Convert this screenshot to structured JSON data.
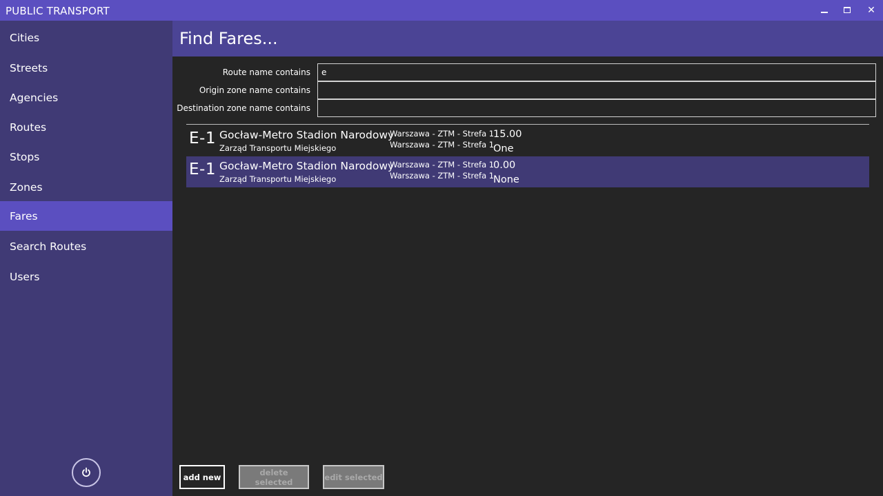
{
  "window": {
    "title": "PUBLIC TRANSPORT",
    "controls": {
      "minimize": "minimize-icon",
      "maximize": "maximize-icon",
      "close": "close-icon",
      "close_glyph": "✕"
    }
  },
  "sidebar": {
    "items": [
      {
        "label": "Cities",
        "active": false
      },
      {
        "label": "Streets",
        "active": false
      },
      {
        "label": "Agencies",
        "active": false
      },
      {
        "label": "Routes",
        "active": false
      },
      {
        "label": "Stops",
        "active": false
      },
      {
        "label": "Zones",
        "active": false
      },
      {
        "label": "Fares",
        "active": true
      },
      {
        "label": "Search Routes",
        "active": false
      },
      {
        "label": "Users",
        "active": false
      }
    ],
    "power_icon": "power-icon"
  },
  "main": {
    "title": "Find Fares...",
    "filters": {
      "route_label": "Route name contains",
      "route_value": "e",
      "origin_label": "Origin zone name contains",
      "origin_value": "",
      "destination_label": "Destination zone name contains",
      "destination_value": ""
    },
    "results": [
      {
        "route_id": "E-1",
        "route_name": "Gocław-Metro Stadion Narodowy",
        "agency": "Zarząd Transportu Miejskiego",
        "origin_zone": "Warszawa - ZTM - Strefa 1",
        "destination_zone": "Warszawa - ZTM - Strefa 1",
        "price": "15.00",
        "transfers": "One",
        "selected": false
      },
      {
        "route_id": "E-1",
        "route_name": "Gocław-Metro Stadion Narodowy",
        "agency": "Zarząd Transportu Miejskiego",
        "origin_zone": "Warszawa - ZTM - Strefa 1",
        "destination_zone": "Warszawa - ZTM - Strefa 1",
        "price": "0.00",
        "transfers": "None",
        "selected": true
      }
    ],
    "buttons": {
      "add_new": "add new",
      "delete_selected": "delete selected",
      "edit_selected": "edit selected"
    }
  },
  "colors": {
    "titlebar": "#5b4fc0",
    "sidebar": "#403a75",
    "active_item": "#5b4fc0",
    "header": "#4b4495",
    "content_bg": "#252525",
    "selected_row": "#403a75",
    "disabled_button": "#7a7a7a"
  }
}
